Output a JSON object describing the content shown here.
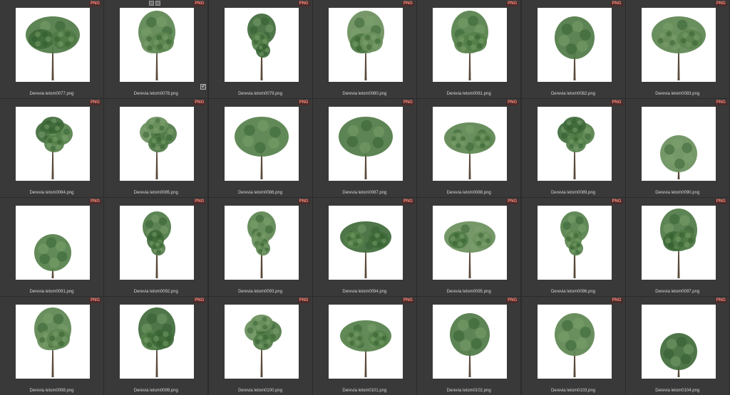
{
  "badge_label": "PNG",
  "colors": {
    "background": "#2b2b2b",
    "cell": "#393939",
    "badge_bg": "#4a2b2b",
    "badge_text": "#ff8a7a",
    "filename_text": "#d6d6d6"
  },
  "files": [
    {
      "name": "Derevia letom0077.png",
      "shape": "broad"
    },
    {
      "name": "Derevia letom0078.png",
      "shape": "tall"
    },
    {
      "name": "Derevia letom0079.png",
      "shape": "slim"
    },
    {
      "name": "Derevia letom0080.png",
      "shape": "tall"
    },
    {
      "name": "Derevia letom0081.png",
      "shape": "tall"
    },
    {
      "name": "Derevia letom0082.png",
      "shape": "round"
    },
    {
      "name": "Derevia letom0083.png",
      "shape": "broad"
    },
    {
      "name": "Derevia letom0084.png",
      "shape": "open"
    },
    {
      "name": "Derevia letom0085.png",
      "shape": "open"
    },
    {
      "name": "Derevia letom0086.png",
      "shape": "dome"
    },
    {
      "name": "Derevia letom0087.png",
      "shape": "dome"
    },
    {
      "name": "Derevia letom0088.png",
      "shape": "wide"
    },
    {
      "name": "Derevia letom0089.png",
      "shape": "open"
    },
    {
      "name": "Derevia letom0090.png",
      "shape": "bush"
    },
    {
      "name": "Derevia letom0091.png",
      "shape": "bush"
    },
    {
      "name": "Derevia letom0092.png",
      "shape": "slim"
    },
    {
      "name": "Derevia letom0093.png",
      "shape": "slim"
    },
    {
      "name": "Derevia letom0094.png",
      "shape": "wide"
    },
    {
      "name": "Derevia letom0095.png",
      "shape": "wide"
    },
    {
      "name": "Derevia letom0096.png",
      "shape": "slim"
    },
    {
      "name": "Derevia letom0097.png",
      "shape": "tall"
    },
    {
      "name": "Derevia letom0098.png",
      "shape": "tall"
    },
    {
      "name": "Derevia letom0099.png",
      "shape": "tall"
    },
    {
      "name": "Derevia letom0100.png",
      "shape": "open"
    },
    {
      "name": "Derevia letom0101.png",
      "shape": "wide"
    },
    {
      "name": "Derevia letom0102.png",
      "shape": "round"
    },
    {
      "name": "Derevia letom0103.png",
      "shape": "round"
    },
    {
      "name": "Derevia letom0104.png",
      "shape": "bush"
    }
  ],
  "hovered_index": 1
}
